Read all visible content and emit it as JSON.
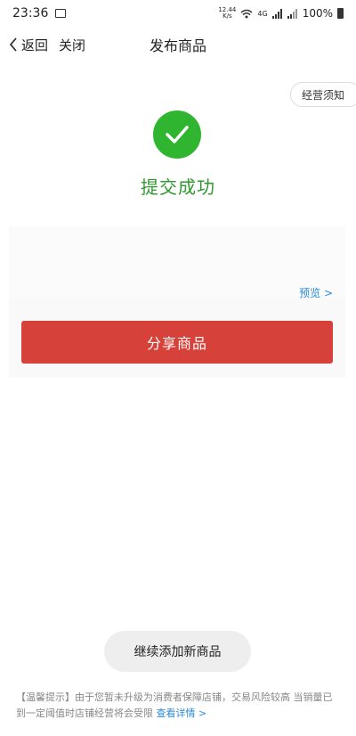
{
  "status_bar": {
    "time": "23:36",
    "net_speed_top": "12.44",
    "net_speed_bottom": "K/s",
    "network": "4G",
    "battery": "100%"
  },
  "nav": {
    "back_label": "返回",
    "close_label": "关闭",
    "title": "发布商品"
  },
  "notice_button": "经营须知",
  "success": {
    "text": "提交成功",
    "color": "#2fb52f"
  },
  "card": {
    "preview_label": "预览 >",
    "share_label": "分享商品",
    "share_color": "#d6413a"
  },
  "continue_label": "继续添加新商品",
  "tip": {
    "text": "【温馨提示】由于您暂未升级为消费者保障店铺，交易风险较高 当销量已到一定阈值时店铺经营将会受限",
    "detail_link": "查看详情 >"
  }
}
